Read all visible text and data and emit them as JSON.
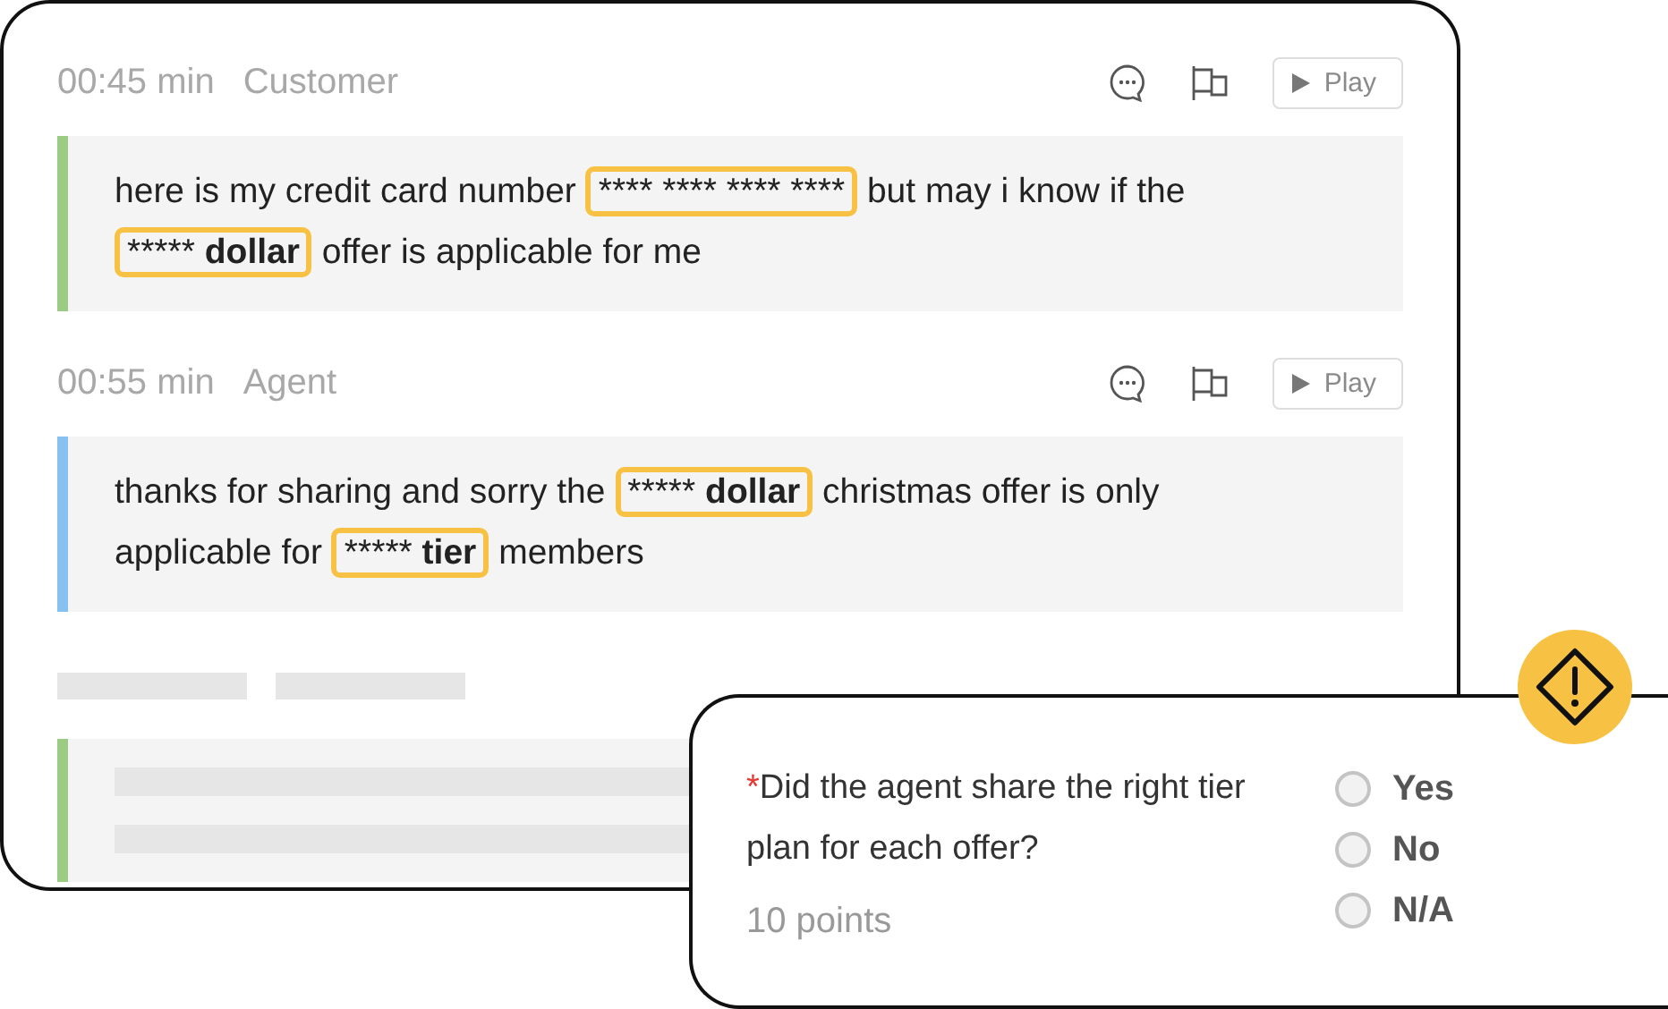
{
  "messages": [
    {
      "time": "00:45 min",
      "speaker": "Customer",
      "color": "#9ccc84",
      "play": "Play",
      "segments": [
        {
          "kind": "text",
          "text": "here is my credit card number"
        },
        {
          "kind": "masked",
          "mask": "**** **** **** ****"
        },
        {
          "kind": "text",
          "text": "but may i know if the"
        },
        {
          "kind": "masked",
          "mask": "*****",
          "word": "dollar"
        },
        {
          "kind": "text",
          "text": "offer is applicable for me"
        }
      ]
    },
    {
      "time": "00:55 min",
      "speaker": "Agent",
      "color": "#86c1f0",
      "play": "Play",
      "segments": [
        {
          "kind": "text",
          "text": "thanks for sharing and sorry the"
        },
        {
          "kind": "masked",
          "mask": "*****",
          "word": "dollar"
        },
        {
          "kind": "text",
          "text": "christmas offer is only applicable for"
        },
        {
          "kind": "masked",
          "mask": "*****",
          "word": "tier"
        },
        {
          "kind": "text",
          "text": "members"
        }
      ]
    }
  ],
  "placeholder_message": {
    "color": "#9ccc84"
  },
  "question": {
    "required": true,
    "mark": "*",
    "text": "Did the agent share the right tier plan for each offer?",
    "points": "10 points",
    "options": [
      {
        "label": "Yes",
        "selected": false
      },
      {
        "label": "No",
        "selected": false
      },
      {
        "label": "N/A",
        "selected": false
      }
    ]
  }
}
